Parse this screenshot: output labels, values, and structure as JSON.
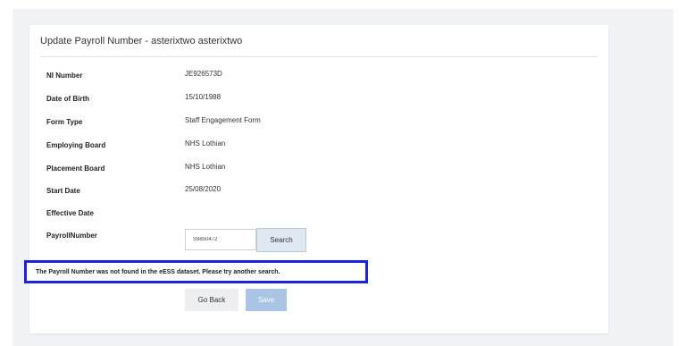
{
  "card": {
    "title": "Update Payroll Number - asterixtwo asterixtwo"
  },
  "fields": [
    {
      "label": "NI Number",
      "value": "JE926573D"
    },
    {
      "label": "Date of Birth",
      "value": "15/10/1988"
    },
    {
      "label": "Form Type",
      "value": "Staff Engagement Form"
    },
    {
      "label": "Employing Board",
      "value": "NHS Lothian"
    },
    {
      "label": "Placement Board",
      "value": "NHS Lothian"
    },
    {
      "label": "Start Date",
      "value": "25/08/2020"
    },
    {
      "label": "Effective Date",
      "value": ""
    },
    {
      "label": "PayrollNumber",
      "value": ""
    }
  ],
  "payroll": {
    "input_value": "S9850472",
    "search_label": "Search"
  },
  "error": {
    "message": "The Payroll Number was not found in the eESS dataset. Please try another search.",
    "highlight_color": "#1a22e6"
  },
  "actions": {
    "go_back_label": "Go Back",
    "save_label": "Save"
  },
  "colors": {
    "background_panel": "#f1f2f6",
    "save_disabled": "#a9c4e4",
    "search_button": "#dfe7f0"
  }
}
